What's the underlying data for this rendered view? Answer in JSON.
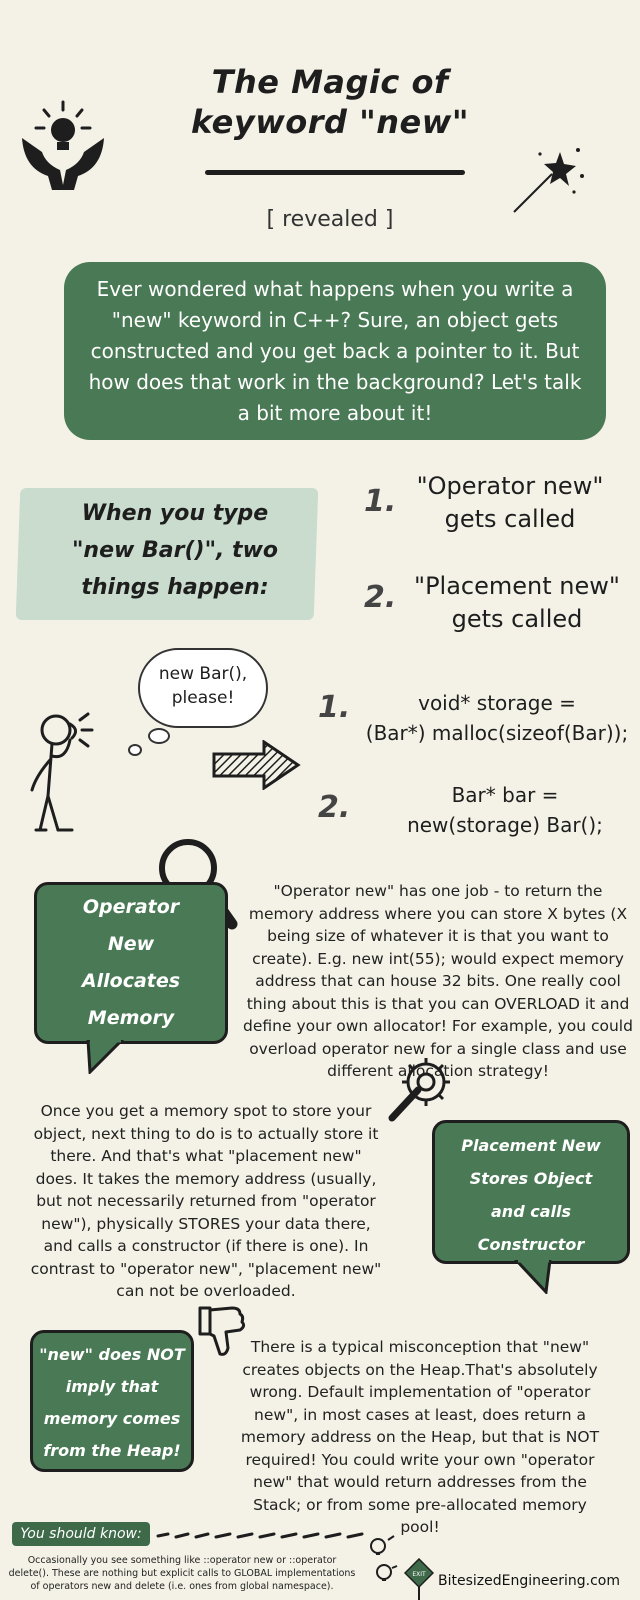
{
  "header": {
    "title_line1": "The Magic of",
    "title_line2": "keyword \"new\"",
    "subtitle": "[ revealed ]"
  },
  "intro": "Ever wondered what happens when you write a \"new\" keyword in C++? Sure, an object gets constructed and you get back a pointer to it. But how does that work in the background? Let's talk a bit more about it!",
  "when_banner": {
    "line1": "When you type",
    "line2": "\"new Bar()\", two",
    "line3": "things happen:"
  },
  "steps": [
    {
      "num": "1.",
      "line1": "\"Operator new\"",
      "line2": "gets called"
    },
    {
      "num": "2.",
      "line1": "\"Placement new\"",
      "line2": "gets called"
    }
  ],
  "bubble": {
    "line1": "new Bar(),",
    "line2": "please!"
  },
  "code": [
    {
      "num": "1.",
      "line1": "void* storage =",
      "line2": "(Bar*) malloc(sizeof(Bar));"
    },
    {
      "num": "2.",
      "line1": "Bar* bar =",
      "line2": "new(storage) Bar();"
    }
  ],
  "operator_card": {
    "line1": "Operator",
    "line2": "New",
    "line3": "Allocates",
    "line4": "Memory"
  },
  "operator_text": "\"Operator new\" has one job - to return the memory address where you can store X bytes (X being size of whatever it is that you want to create). E.g. new int(55); would expect memory address that can house 32 bits. One really cool thing about this is that you can OVERLOAD it and define your own allocator! For example, you could overload operator new for a single class and use different allocation strategy!",
  "placement_text": "Once you get a memory spot to store your object, next thing to do is to actually store it there. And that's what \"placement new\" does. It takes the memory address (usually, but not necessarily returned from \"operator new\"), physically STORES your data there, and calls a constructor (if there is one). In contrast to \"operator new\", \"placement new\" can not be overloaded.",
  "placement_card": {
    "line1": "Placement New",
    "line2": "Stores  Object",
    "line3": "and calls",
    "line4": "Constructor"
  },
  "heap_card": {
    "line1": "\"new\" does NOT",
    "line2": "imply that",
    "line3": "memory comes",
    "line4": "from the Heap!"
  },
  "heap_text": "There is a typical misconception that \"new\" creates objects on the Heap.That's absolutely wrong. Default implementation of \"operator new\", in most cases at least, does return a memory address on the Heap, but that is NOT required! You could write your own \"operator new\" that would return addresses from the Stack; or from some pre-allocated memory pool!",
  "footer": {
    "know_label": "You should know:",
    "know_text": "Occasionally you see something like ::operator new or ::operator delete(). These are nothing but explicit calls to GLOBAL implementations of operators new and delete (i.e. ones from global namespace).",
    "exit_sign": "EXIT",
    "site": "BitesizedEngineering.com"
  },
  "colors": {
    "background": "#f4f2e6",
    "accent_green": "#4a7a55",
    "banner_green": "#c9dccd",
    "ink": "#1e1e1e"
  }
}
